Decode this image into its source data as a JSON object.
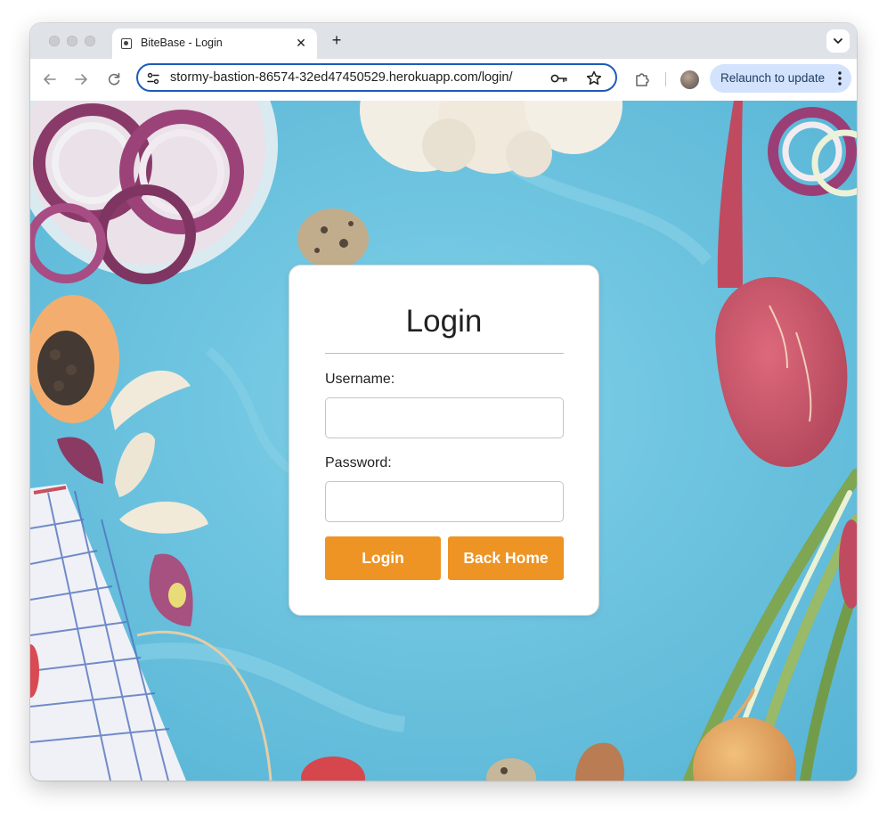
{
  "browser": {
    "tab_title": "BiteBase - Login",
    "tab_close_glyph": "✕",
    "new_tab_glyph": "+",
    "url": "stormy-bastion-86574-32ed47450529.herokuapp.com/login/",
    "relaunch_label": "Relaunch to update",
    "icons": {
      "favicon": "page-icon",
      "back": "arrow-left-icon",
      "forward": "arrow-right-icon",
      "reload": "reload-icon",
      "site_settings": "tune-icon",
      "password": "key-icon",
      "bookmark": "star-icon",
      "extensions": "puzzle-icon",
      "profile": "avatar",
      "menu": "kebab-menu-icon",
      "tab_search": "chevron-down-icon"
    },
    "colors": {
      "omnibox_focus": "#1e5bb8",
      "relaunch_bg": "#d3e3fd",
      "tabstrip_bg": "#dfe3e8"
    }
  },
  "page": {
    "background_color": "#5bc0dd",
    "login_card": {
      "title": "Login",
      "username_label": "Username:",
      "username_value": "",
      "password_label": "Password:",
      "password_value": "",
      "login_button": "Login",
      "back_home_button": "Back Home",
      "button_color": "#ee9424"
    }
  }
}
